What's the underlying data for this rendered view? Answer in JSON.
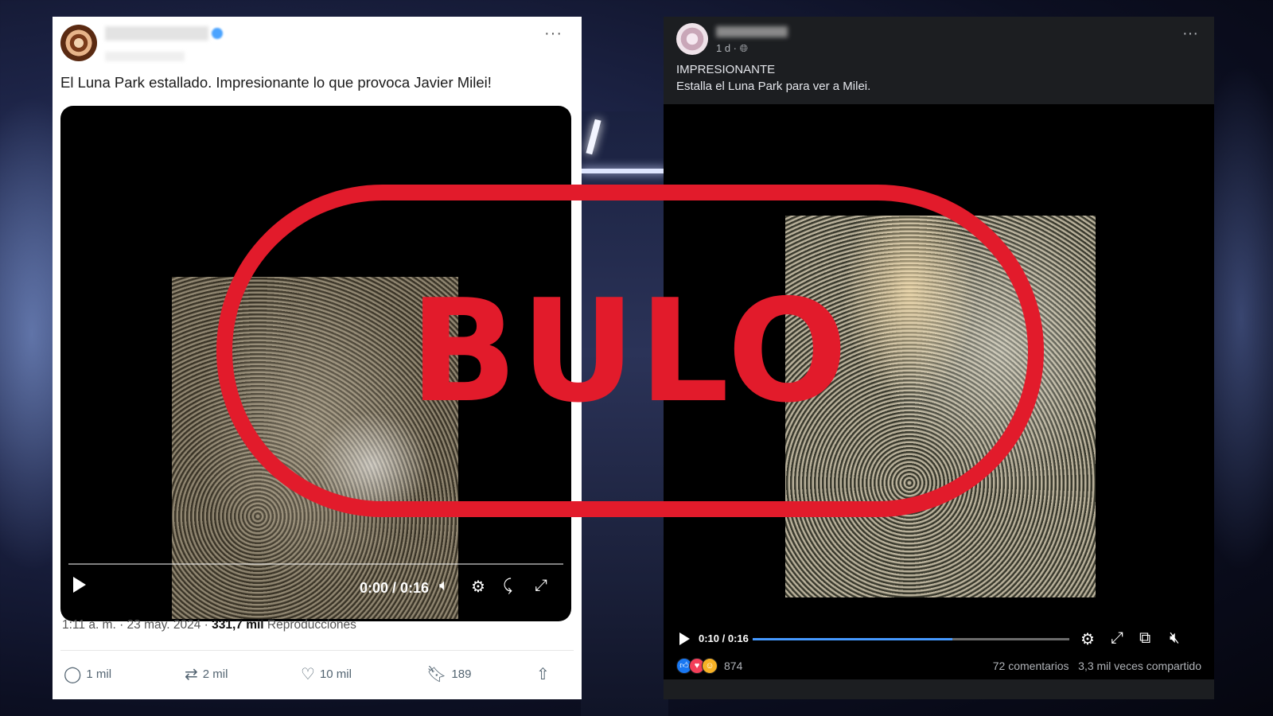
{
  "tweet": {
    "text": "El Luna Park estallado. Impresionante lo que provoca Javier Milei!",
    "video": {
      "time": "0:00 / 0:16",
      "icons": [
        "play-icon",
        "volume-icon",
        "settings-icon",
        "rotate-icon",
        "fullscreen-icon"
      ]
    },
    "meta_prefix": "1:11 a. m. · 23 may. 2024 · ",
    "views": "331,7 mil",
    "views_label": " Reproducciones",
    "actions": {
      "replies": "1 mil",
      "reposts": "2 mil",
      "likes": "10 mil",
      "bookmarks": "189"
    }
  },
  "facebook": {
    "age": "1 d ·",
    "line1": "IMPRESIONANTE",
    "line2": "Estalla el Luna Park para ver a Milei.",
    "video": {
      "time": "0:10 / 0:16",
      "progress": 0.63
    },
    "reactions_count": "874",
    "comments": "72 comentarios",
    "shares": "3,3 mil veces compartido",
    "colors": {
      "like": "#1877f2",
      "love": "#f33e58",
      "haha": "#f7b125"
    }
  },
  "stamp": {
    "label": "BULO",
    "color": "#e21b2b"
  }
}
